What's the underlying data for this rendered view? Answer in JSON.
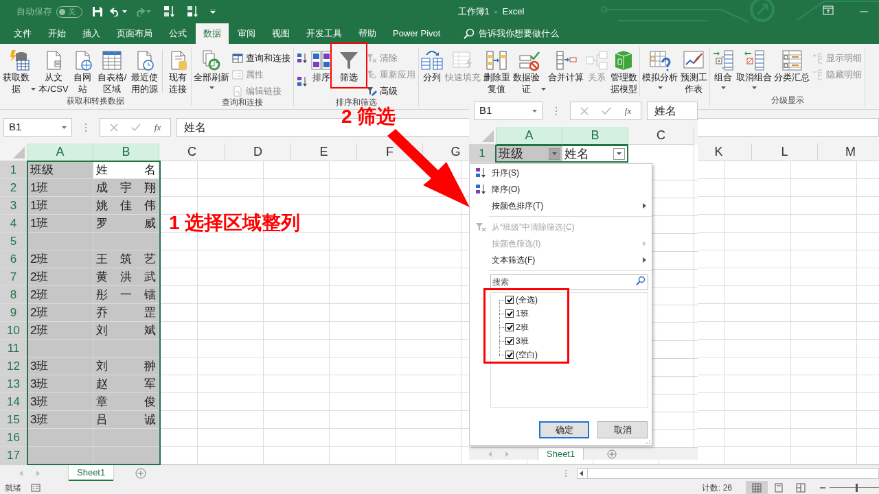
{
  "title_bar": {
    "autosave_label": "自动保存",
    "autosave": {
      "on": false,
      "label": "关"
    },
    "title": "工作簿1  -  Excel"
  },
  "menu_tabs": [
    {
      "label": "文件",
      "selected": false
    },
    {
      "label": "开始",
      "selected": false
    },
    {
      "label": "插入",
      "selected": false
    },
    {
      "label": "页面布局",
      "selected": false
    },
    {
      "label": "公式",
      "selected": false
    },
    {
      "label": "数据",
      "selected": true
    },
    {
      "label": "审阅",
      "selected": false
    },
    {
      "label": "视图",
      "selected": false
    },
    {
      "label": "开发工具",
      "selected": false
    },
    {
      "label": "帮助",
      "selected": false
    },
    {
      "label": "Power Pivot",
      "selected": false
    }
  ],
  "tell_me": "告诉我你想要做什么",
  "ribbon_groups": [
    {
      "label": "获取和转换数据",
      "items": [
        {
          "kind": "large",
          "label": "获取数据",
          "dropdown": true,
          "disabled": false
        },
        {
          "kind": "large",
          "label": "从文本/CSV",
          "disabled": false
        },
        {
          "kind": "large",
          "label": "自网站",
          "disabled": false
        },
        {
          "kind": "large",
          "label": "自表格/区域",
          "disabled": false
        },
        {
          "kind": "large",
          "label": "最近使用的源",
          "disabled": false
        },
        {
          "kind": "separator"
        },
        {
          "kind": "large",
          "label": "现有连接",
          "disabled": false
        }
      ]
    },
    {
      "label": "查询和连接",
      "items": [
        {
          "kind": "large",
          "label": "全部刷新",
          "dropdown": true,
          "disabled": false
        },
        {
          "kind": "stack",
          "buttons": [
            {
              "label": "查询和连接",
              "disabled": false
            },
            {
              "label": "属性",
              "disabled": true
            },
            {
              "label": "编辑链接",
              "disabled": true
            }
          ]
        }
      ]
    },
    {
      "label": "排序和筛选",
      "items": [
        {
          "kind": "stack",
          "buttons": [
            {
              "disabled": false
            },
            {
              "disabled": false
            }
          ]
        },
        {
          "kind": "large",
          "label": "排序",
          "disabled": false
        },
        {
          "kind": "large",
          "label": "筛选",
          "disabled": false
        },
        {
          "kind": "stack",
          "buttons": [
            {
              "label": "清除",
              "disabled": true
            },
            {
              "label": "重新应用",
              "disabled": true
            },
            {
              "label": "高级",
              "disabled": false
            }
          ]
        }
      ]
    },
    {
      "items": [
        {
          "kind": "large",
          "label": "分列",
          "disabled": false
        },
        {
          "kind": "large",
          "label": "快速填充",
          "disabled": true
        },
        {
          "kind": "large",
          "label": "删除重复值",
          "disabled": false
        },
        {
          "kind": "large",
          "label": "数据验证",
          "dropdown": true,
          "disabled": false
        },
        {
          "kind": "large",
          "label": "合并计算",
          "disabled": false
        },
        {
          "kind": "large",
          "label": "关系",
          "disabled": true
        },
        {
          "kind": "large",
          "label": "管理数据模型",
          "disabled": false
        }
      ]
    },
    {
      "items": [
        {
          "kind": "large",
          "label": "模拟分析",
          "dropdown": true,
          "disabled": false
        },
        {
          "kind": "large",
          "label": "预测工作表",
          "disabled": false
        }
      ]
    },
    {
      "label": "分级显示",
      "items": [
        {
          "kind": "large",
          "label": "组合",
          "dropdown": true,
          "disabled": false
        },
        {
          "kind": "large",
          "label": "取消组合",
          "dropdown": true,
          "disabled": false
        },
        {
          "kind": "large",
          "label": "分类汇总",
          "disabled": false
        },
        {
          "kind": "stack",
          "buttons": [
            {
              "label": "显示明细",
              "disabled": true
            },
            {
              "label": "隐藏明细",
              "disabled": true
            }
          ]
        }
      ]
    }
  ],
  "formula_bar": {
    "name_box": "B1",
    "function_label": "fx",
    "value": "姓名"
  },
  "sheet": {
    "columns_left": [
      {
        "label": "A",
        "selected": true
      },
      {
        "label": "B",
        "selected": true
      },
      {
        "label": "C",
        "selected": false
      },
      {
        "label": "D",
        "selected": false
      },
      {
        "label": "E",
        "selected": false
      },
      {
        "label": "F",
        "selected": false
      },
      {
        "label": "G",
        "selected": false
      }
    ],
    "columns_right": [
      {
        "label": "K",
        "selected": false
      },
      {
        "label": "L",
        "selected": false
      },
      {
        "label": "M",
        "selected": false
      }
    ],
    "rows": [
      {
        "number": "1",
        "selected": true,
        "cells": [
          {
            "text": "班级",
            "selected": true
          },
          {
            "text": "姓名",
            "selected": false
          }
        ]
      },
      {
        "number": "2",
        "selected": true,
        "cells": [
          {
            "text": "1班",
            "selected": true
          },
          {
            "text": "成 宇 翔",
            "selected": true
          }
        ]
      },
      {
        "number": "3",
        "selected": true,
        "cells": [
          {
            "text": "1班",
            "selected": true
          },
          {
            "text": "姚 佳 伟",
            "selected": true
          }
        ]
      },
      {
        "number": "4",
        "selected": true,
        "cells": [
          {
            "text": "1班",
            "selected": true
          },
          {
            "text": "罗 威",
            "selected": true
          }
        ]
      },
      {
        "number": "5",
        "selected": true,
        "cells": [
          {
            "selected": true
          },
          {
            "selected": true
          }
        ]
      },
      {
        "number": "6",
        "selected": true,
        "cells": [
          {
            "text": "2班",
            "selected": true
          },
          {
            "text": "王 筑 艺",
            "selected": true
          }
        ]
      },
      {
        "number": "7",
        "selected": true,
        "cells": [
          {
            "text": "2班",
            "selected": true
          },
          {
            "text": "黄 洪 武",
            "selected": true
          }
        ]
      },
      {
        "number": "8",
        "selected": true,
        "cells": [
          {
            "text": "2班",
            "selected": true
          },
          {
            "text": "彤 一 镭",
            "selected": true
          }
        ]
      },
      {
        "number": "9",
        "selected": true,
        "cells": [
          {
            "text": "2班",
            "selected": true
          },
          {
            "text": "乔 罡",
            "selected": true
          }
        ]
      },
      {
        "number": "10",
        "selected": true,
        "cells": [
          {
            "text": "2班",
            "selected": true
          },
          {
            "text": "刘 斌",
            "selected": true
          }
        ]
      },
      {
        "number": "11",
        "selected": true,
        "cells": [
          {
            "selected": true
          },
          {
            "selected": true
          }
        ]
      },
      {
        "number": "12",
        "selected": true,
        "cells": [
          {
            "text": "3班",
            "selected": true
          },
          {
            "text": "刘 翀",
            "selected": true
          }
        ]
      },
      {
        "number": "13",
        "selected": true,
        "cells": [
          {
            "text": "3班",
            "selected": true
          },
          {
            "text": "赵 军",
            "selected": true
          }
        ]
      },
      {
        "number": "14",
        "selected": true,
        "cells": [
          {
            "text": "3班",
            "selected": true
          },
          {
            "text": "章 俊",
            "selected": true
          }
        ]
      },
      {
        "number": "15",
        "selected": true,
        "cells": [
          {
            "text": "3班",
            "selected": true
          },
          {
            "text": "吕 诚",
            "selected": true
          }
        ]
      },
      {
        "number": "16",
        "selected": true,
        "cells": [
          {
            "selected": true
          },
          {
            "selected": true
          }
        ]
      },
      {
        "number": "17",
        "selected": true,
        "cells": [
          {
            "selected": true
          },
          {
            "selected": true
          }
        ]
      }
    ]
  },
  "sheet_tabs": [
    {
      "label": "Sheet1",
      "selected": true
    }
  ],
  "status_bar": {
    "mode": "就绪",
    "count": "计数: 26",
    "views": [
      {
        "selected": true
      },
      {
        "selected": false
      },
      {
        "selected": false
      }
    ]
  },
  "filter_popup": {
    "name_box": "B1",
    "function_label": "fx",
    "value": "姓名",
    "columns": [
      {
        "label": "A",
        "selected": true
      },
      {
        "label": "B",
        "selected": true
      },
      {
        "label": "C",
        "selected": false
      }
    ],
    "row_number": "1",
    "header_cells": [
      "班级",
      "姓名"
    ],
    "menu": [
      {
        "kind": "item",
        "label": "升序(S)",
        "disabled": false,
        "submenu": false
      },
      {
        "kind": "item",
        "label": "降序(O)",
        "disabled": false,
        "submenu": false
      },
      {
        "kind": "item",
        "label": "按颜色排序(T)",
        "disabled": false,
        "submenu": true
      },
      {
        "kind": "separator"
      },
      {
        "kind": "item",
        "label": "从“班级”中清除筛选(C)",
        "disabled": true,
        "submenu": false
      },
      {
        "kind": "item",
        "label": "按颜色筛选(I)",
        "disabled": true,
        "submenu": true
      },
      {
        "kind": "item",
        "label": "文本筛选(F)",
        "disabled": false,
        "submenu": true
      },
      {
        "kind": "separator"
      }
    ],
    "search_placeholder": "搜索",
    "values": [
      {
        "label": "(全选)",
        "checked": true
      },
      {
        "label": "1班",
        "checked": true
      },
      {
        "label": "2班",
        "checked": true
      },
      {
        "label": "3班",
        "checked": true
      },
      {
        "label": "(空白)",
        "checked": true
      }
    ],
    "buttons": [
      {
        "label": "确定",
        "default": true
      },
      {
        "label": "取消",
        "default": false
      }
    ],
    "sheet_tab": "Sheet1"
  },
  "annotations": {
    "step1": "1 选择区域整列",
    "step2": "2 筛选"
  }
}
